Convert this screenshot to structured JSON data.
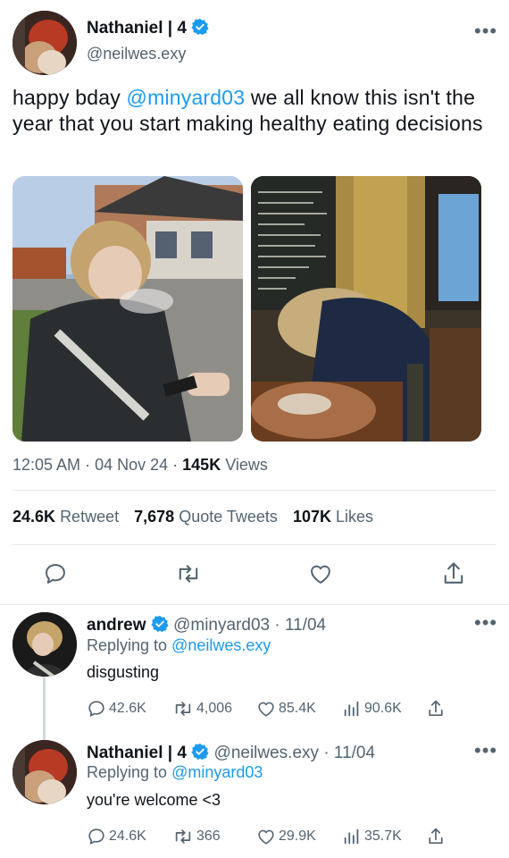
{
  "main_tweet": {
    "author_name": "Nathaniel | 4",
    "handle": "@neilwes.exy",
    "text_pre": "happy bday ",
    "mention": "@minyard03",
    "text_post": " we all know this isn't the year that you start making healthy eating decisions",
    "time": "12:05 AM",
    "date": "04 Nov 24",
    "views_count": "145K",
    "views_label": "Views",
    "retweets_count": "24.6K",
    "retweets_label": "Retweet",
    "quotes_count": "7,678",
    "quotes_label": "Quote Tweets",
    "likes_count": "107K",
    "likes_label": "Likes"
  },
  "replies": [
    {
      "author_name": "andrew",
      "handle": "@minyard03",
      "date": "11/04",
      "replying_label": "Replying to",
      "replying_to": "@neilwes.exy",
      "text": "disgusting",
      "comments": "42.6K",
      "retweets": "4,006",
      "likes": "85.4K",
      "views": "90.6K"
    },
    {
      "author_name": "Nathaniel | 4",
      "handle": "@neilwes.exy",
      "date": "11/04",
      "replying_label": "Replying to",
      "replying_to": "@minyard03",
      "text": "you're welcome <3",
      "comments": "24.6K",
      "retweets": "366",
      "likes": "29.9K",
      "views": "35.7K"
    }
  ],
  "icons": {
    "verified": "verified-badge-icon",
    "more": "more-options-icon",
    "reply": "reply-icon",
    "retweet": "retweet-icon",
    "like": "heart-icon",
    "share": "share-icon",
    "views": "views-icon"
  },
  "colors": {
    "accent": "#1d9bf0",
    "secondary_text": "#536471",
    "divider": "#e6e9eb"
  }
}
